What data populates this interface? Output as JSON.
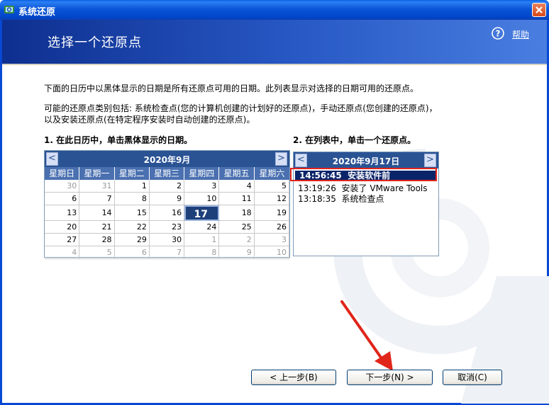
{
  "window": {
    "title": "系统还原"
  },
  "header": {
    "heading": "选择一个还原点",
    "help_label": "帮助"
  },
  "body": {
    "intro": "下面的日历中以黑体显示的日期是所有还原点可用的日期。此列表显示对选择的日期可用的还原点。",
    "types_line1": "可能的还原点类别包括: 系统检查点(您的计算机创建的计划好的还原点)，手动还原点(您创建的还原点)，",
    "types_line2": "以及安装还原点(在特定程序安装时自动创建的还原点)。",
    "step1": "1. 在此日历中，单击黑体显示的日期。",
    "step2": "2. 在列表中，单击一个还原点。"
  },
  "calendar": {
    "title": "2020年9月",
    "prev": "<",
    "next": ">",
    "weekdays": [
      "星期日",
      "星期一",
      "星期二",
      "星期三",
      "星期四",
      "星期五",
      "星期六"
    ],
    "weeks": [
      [
        "30",
        "31",
        "1",
        "2",
        "3",
        "4",
        "5"
      ],
      [
        "6",
        "7",
        "8",
        "9",
        "10",
        "11",
        "12"
      ],
      [
        "13",
        "14",
        "15",
        "16",
        "17",
        "18",
        "19"
      ],
      [
        "20",
        "21",
        "22",
        "23",
        "24",
        "25",
        "26"
      ],
      [
        "27",
        "28",
        "29",
        "30",
        "1",
        "2",
        "3"
      ],
      [
        "4",
        "5",
        "6",
        "7",
        "8",
        "9",
        "10"
      ]
    ],
    "selected_day": "17"
  },
  "restore_list": {
    "title": "2020年9月17日",
    "prev": "<",
    "next": ">",
    "items": [
      {
        "time": "14:56:45",
        "label": "安装软件前"
      },
      {
        "time": "13:19:26",
        "label": "安装了 VMware Tools"
      },
      {
        "time": "13:18:35",
        "label": "系统检查点"
      }
    ]
  },
  "buttons": {
    "back": "< 上一步(B)",
    "next": "下一步(N) >",
    "cancel": "取消(C)"
  },
  "colors": {
    "accent": "#0a246a",
    "highlight": "#e0251b",
    "header": "#2a5394"
  },
  "icons": [
    "system-restore-icon",
    "close-icon",
    "help-icon",
    "arrow-annotation-icon"
  ]
}
